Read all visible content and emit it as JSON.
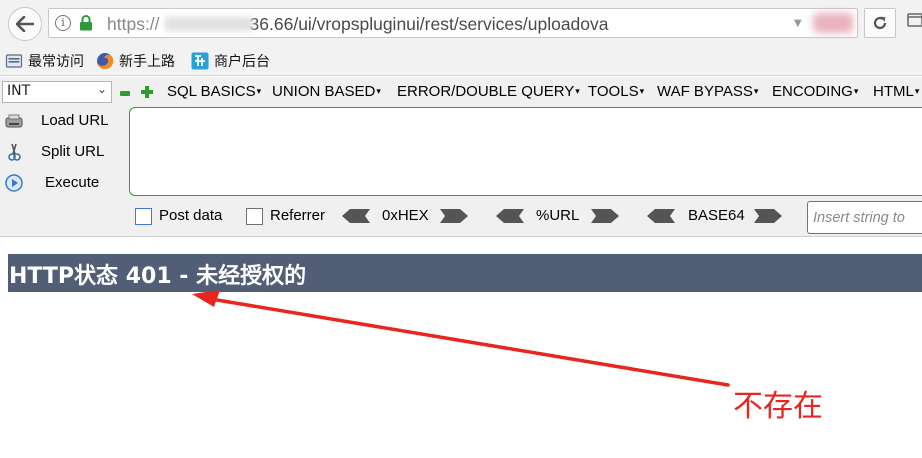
{
  "browser": {
    "url": {
      "scheme": "https://",
      "host_visible": "36.66",
      "path": "/ui/vropspluginui/rest/services/uploadova"
    },
    "dropdown_glyph": "▼"
  },
  "bookmarks": [
    {
      "label": "最常访问",
      "icon": "bookmark-folder-icon"
    },
    {
      "label": "新手上路",
      "icon": "firefox-logo-icon"
    },
    {
      "label": "商户后台",
      "icon": "merchant-site-icon"
    }
  ],
  "hackbar": {
    "type_select": {
      "value": "INT"
    },
    "menus": [
      {
        "label": "SQL BASICS"
      },
      {
        "label": "UNION BASED"
      },
      {
        "label": "ERROR/DOUBLE QUERY"
      },
      {
        "label": "TOOLS"
      },
      {
        "label": "WAF BYPASS"
      },
      {
        "label": "ENCODING"
      },
      {
        "label": "HTML"
      }
    ],
    "menu_caret": "▾",
    "side_buttons": [
      {
        "label": "Load URL",
        "icon": "load-url-icon"
      },
      {
        "label": "Split URL",
        "icon": "scissors-icon"
      },
      {
        "label": "Execute",
        "icon": "play-icon"
      }
    ],
    "options": {
      "post_data": "Post data",
      "referrer": "Referrer",
      "hex": "0xHEX",
      "url": "%URL",
      "base64": "BASE64"
    },
    "insert_placeholder": "Insert string to"
  },
  "page": {
    "error_title": "HTTP状态 401 - 未经授权的"
  },
  "annotation": {
    "text": "不存在",
    "color": "#e8261f"
  },
  "colors": {
    "error_bar": "#525d76",
    "hackbar_border": "#3a9a3a"
  }
}
